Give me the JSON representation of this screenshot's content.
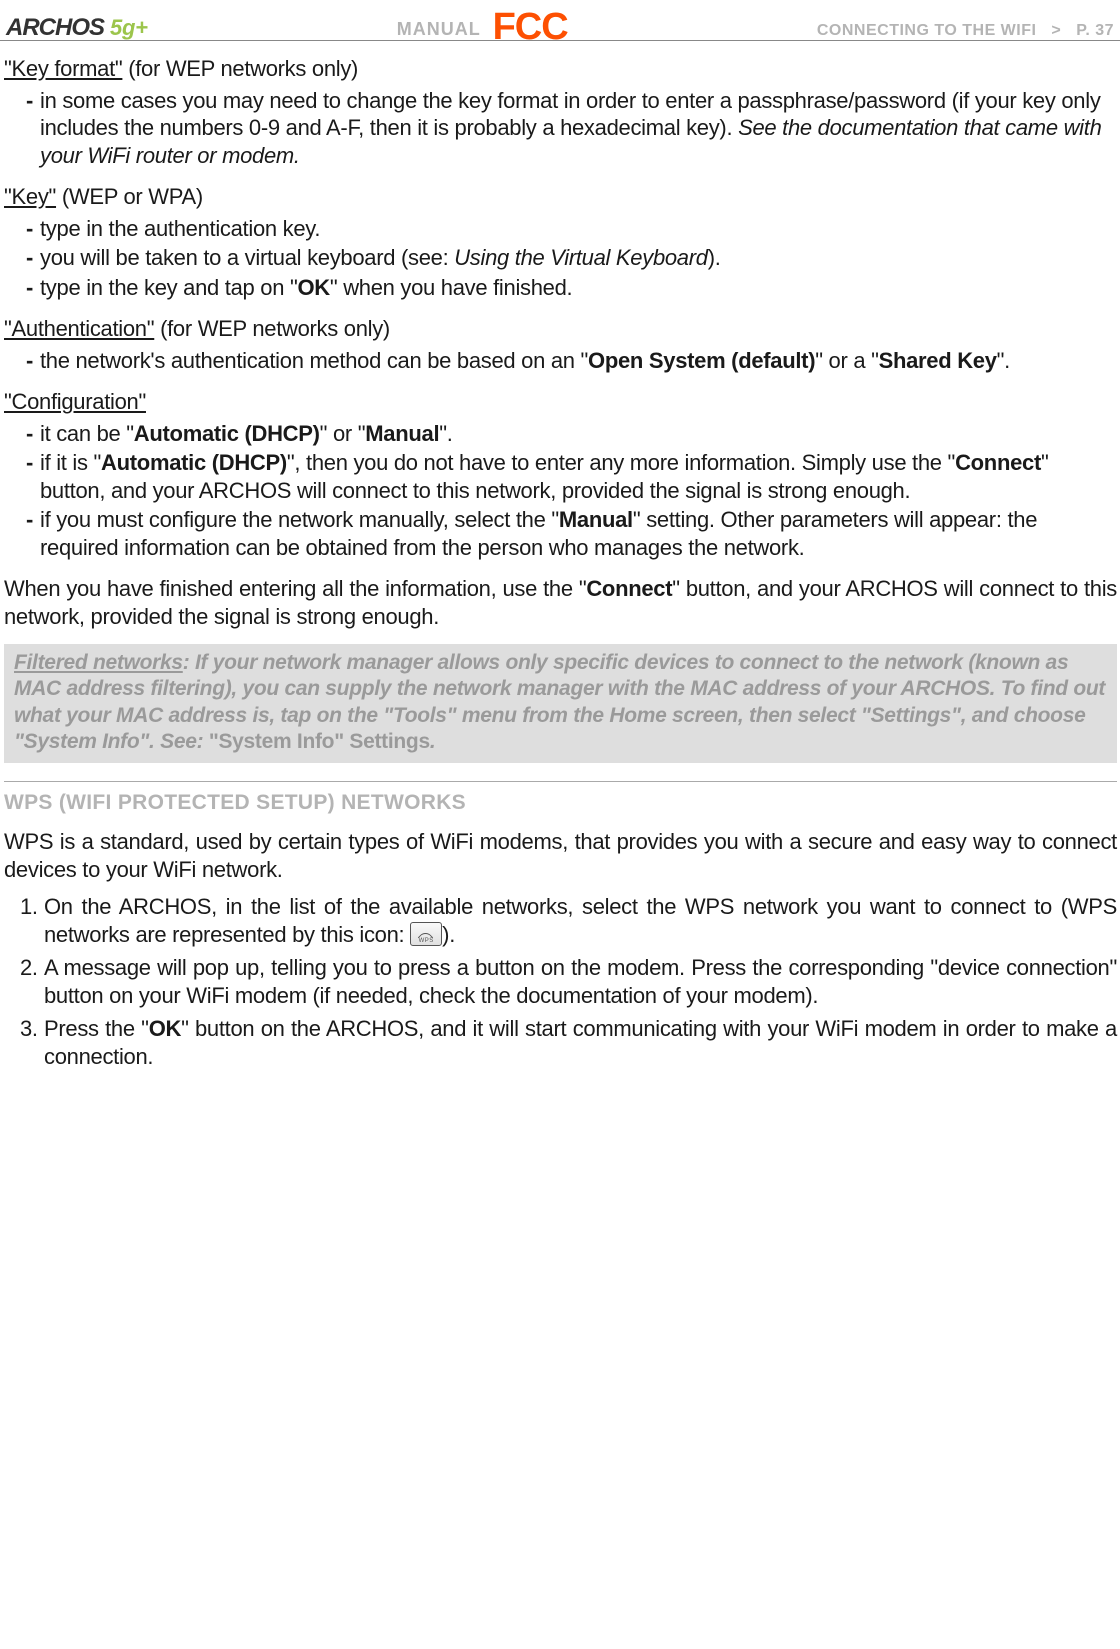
{
  "header": {
    "logo_main": "ARCHOS",
    "logo_sub": "5g+",
    "manual": "MANUAL",
    "fcc": "FCC",
    "section": "CONNECTING TO THE WIFI",
    "gt": ">",
    "page": "P. 37"
  },
  "sections": {
    "keyformat": {
      "label": "\"Key format\"",
      "context": " (for WEP networks only)",
      "b1_a": "in some cases you may need to change the key format in order to enter a passphrase/password (if your key only includes the numbers 0-9 and A-F, then it is probably a hexadecimal key). ",
      "b1_i": "See the documentation that came with your WiFi router or modem."
    },
    "key": {
      "label": "\"Key\"",
      "context": " (WEP or WPA)",
      "b1": "type in the authentication key.",
      "b2_a": "you will be taken to a virtual keyboard (see: ",
      "b2_i": "Using the Virtual Keyboard",
      "b2_b": ").",
      "b3_a": "type in the key and tap on \"",
      "b3_bold": "OK",
      "b3_b": "\" when you have finished."
    },
    "auth": {
      "label": "\"Authentication\"",
      "context": " (for WEP networks only)",
      "b1_a": "the network's authentication method can be based on an \"",
      "b1_bold1": "Open System (default)",
      "b1_mid": "\" or a \"",
      "b1_bold2": "Shared Key",
      "b1_end": "\"."
    },
    "config": {
      "label": "\"Configuration\"",
      "b1_a": "it can be \"",
      "b1_bold1": "Automatic (DHCP)",
      "b1_mid": "\" or \"",
      "b1_bold2": "Manual",
      "b1_end": "\".",
      "b2_a": "if it is \"",
      "b2_bold1": "Automatic (DHCP)",
      "b2_mid": "\", then you do not have to enter any more information. Simply use the \"",
      "b2_bold2": "Connect",
      "b2_end": "\" button, and your ARCHOS will connect to this network, provided the signal is strong enough.",
      "b3_a": "if you must configure the network manually, select the \"",
      "b3_bold": "Manual",
      "b3_end": "\" setting. Other parameters will appear: the required information can be obtained from the person who manages the network."
    },
    "finish_a": "When you have finished entering all the information, use the \"",
    "finish_bold": "Connect",
    "finish_b": "\" button, and your ARCHOS will connect to this network, provided the signal is strong enough.",
    "infobox": {
      "lead": "Filtered networks",
      "body": ": If your network manager allows only specific devices to connect to the network (known as MAC address filtering), you can supply the network manager with the MAC address of your ARCHOS. To find out what your MAC address is, tap on the \"Tools\" menu from the Home screen, then select \"Settings\", and choose \"System Info\". See: ",
      "tail": "\"System Info\" Settings",
      "dot": "."
    },
    "wps": {
      "heading": "WPS (WIFI PROTECTED SETUP) NETWORKS",
      "intro": "WPS is a standard, used by certain types of WiFi modems, that provides you with a secure and easy way to connect devices to your WiFi network.",
      "s1_a": "On the ARCHOS, in the list of the available networks, select the WPS network you want to connect to (WPS networks are represented by this icon: ",
      "s1_b": ").",
      "s2": "A message will pop up, telling you to press a button on the modem. Press the corresponding \"device connection\" button on your WiFi modem (if needed, check the documentation of your modem).",
      "s3_a": "Press the \"",
      "s3_bold": "OK",
      "s3_b": "\" button on the ARCHOS, and it will start communicating with your WiFi modem in order to make a connection.",
      "icon_label": "WPS"
    }
  },
  "numbers": {
    "n1": "1.",
    "n2": "2.",
    "n3": "3."
  },
  "dash": "-"
}
